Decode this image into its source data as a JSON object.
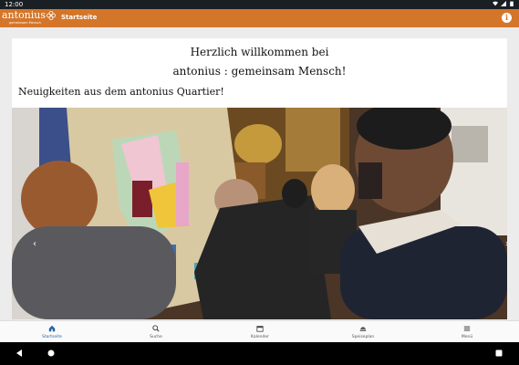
{
  "status_bar": {
    "time": "12:00"
  },
  "app_bar": {
    "logo_text": "antonius",
    "logo_subtitle": "gemeinsam Mensch",
    "title": "Startseite"
  },
  "content": {
    "welcome_line1": "Herzlich willkommen bei",
    "welcome_line2": "antonius : gemeinsam Mensch!",
    "news_heading": "Neuigkeiten aus dem antonius Quartier!"
  },
  "carousel": {
    "prev_symbol": "‹",
    "next_symbol": "›"
  },
  "bottom_nav": {
    "items": [
      {
        "label": "Startseite",
        "icon": "home-icon",
        "active": true
      },
      {
        "label": "Suche",
        "icon": "search-icon",
        "active": false
      },
      {
        "label": "Kalender",
        "icon": "calendar-icon",
        "active": false
      },
      {
        "label": "Speiseplan",
        "icon": "food-icon",
        "active": false
      },
      {
        "label": "Menü",
        "icon": "menu-icon",
        "active": false
      }
    ]
  },
  "colors": {
    "brand": "#d4762a",
    "active_nav": "#2962a8"
  }
}
